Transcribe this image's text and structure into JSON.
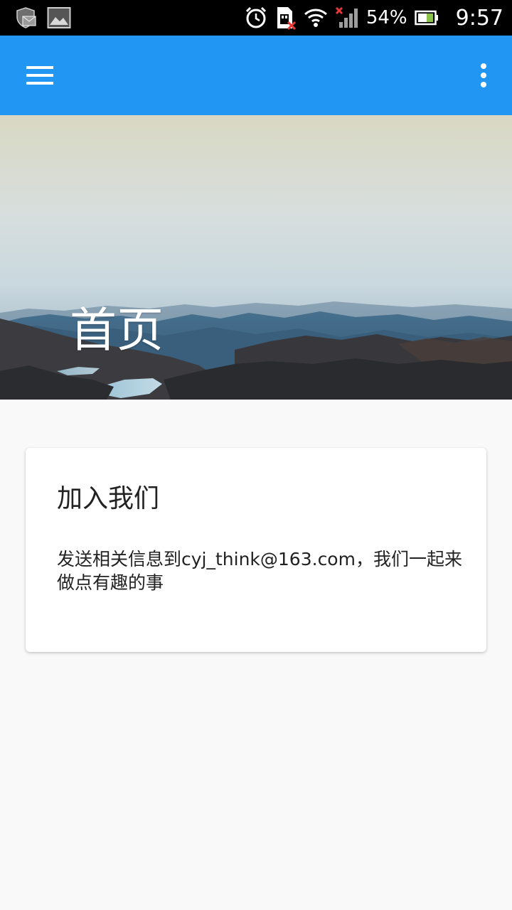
{
  "status_bar": {
    "battery_percent": "54%",
    "time": "9:57",
    "icons_left": [
      "shield-mail-icon",
      "image-icon"
    ],
    "icons_right": [
      "alarm-icon",
      "sim-card-error-icon",
      "wifi-icon",
      "signal-no-service-icon",
      "battery-icon"
    ]
  },
  "toolbar": {
    "background": "#2196f3",
    "menu_icon": "menu-icon",
    "more_icon": "more-vert-icon"
  },
  "hero": {
    "title": "首页"
  },
  "card": {
    "title": "加入我们",
    "body": "发送相关信息到cyj_think@163.com，我们一起来做点有趣的事"
  }
}
